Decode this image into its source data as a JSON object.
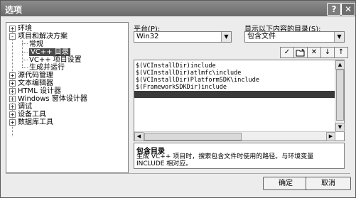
{
  "window": {
    "title": "选项",
    "help_icon": "question-icon",
    "close_icon": "close-icon"
  },
  "tree": {
    "items": [
      {
        "label": "环境",
        "expander": "+"
      },
      {
        "label": "项目和解决方案",
        "expander": "-"
      },
      {
        "label": "常规"
      },
      {
        "label": "VC++ 目录",
        "selected": true
      },
      {
        "label": "VC++ 项目设置"
      },
      {
        "label": "生成并运行"
      },
      {
        "label": "源代码管理",
        "expander": "+"
      },
      {
        "label": "文本编辑器",
        "expander": "+"
      },
      {
        "label": "HTML 设计器",
        "expander": "+"
      },
      {
        "label": "Windows 窗体设计器",
        "expander": "+"
      },
      {
        "label": "调试",
        "expander": "+"
      },
      {
        "label": "设备工具",
        "expander": "+"
      },
      {
        "label": "数据库工具",
        "expander": "+"
      }
    ]
  },
  "platform": {
    "label": "平台(P):",
    "value": "Win32"
  },
  "dirs_for": {
    "label": "显示以下内容的目录(S):",
    "value": "包含文件"
  },
  "toolbar": {
    "check": "✓",
    "folder": "new-folder-icon",
    "delete": "✕",
    "down": "↓",
    "up": "↑"
  },
  "directories": [
    "$(VCInstallDir)include",
    "$(VCInstallDir)atlmfc\\include",
    "$(VCInstallDir)PlatformSDK\\include",
    "$(FrameworkSDKDir)include",
    ""
  ],
  "description": {
    "title": "包含目录",
    "text": "生成 VC++ 项目时，搜索包含文件时使用的路径。与环境变量 INCLUDE 相对应。"
  },
  "buttons": {
    "ok": "确定",
    "cancel": "取消"
  }
}
